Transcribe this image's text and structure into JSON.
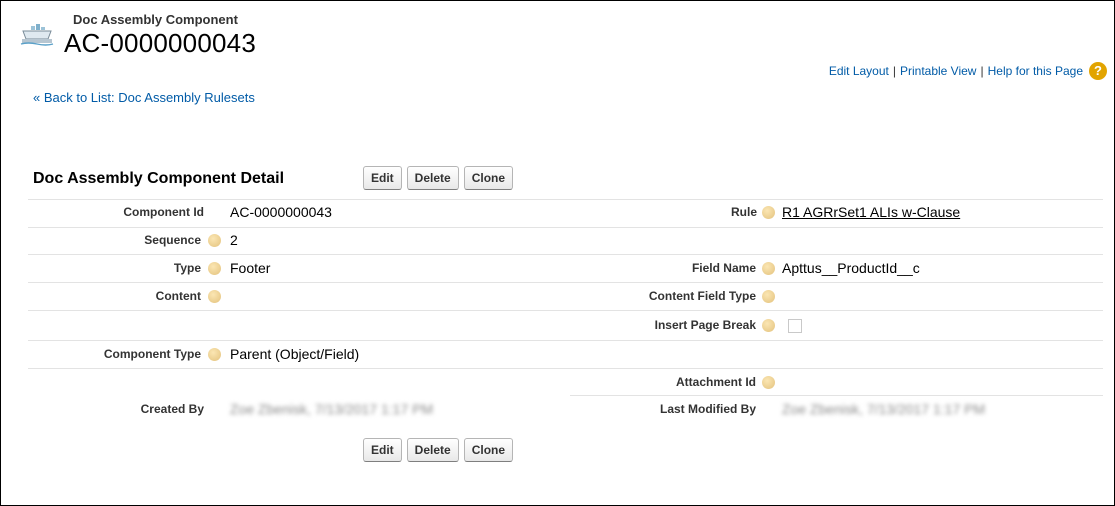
{
  "header": {
    "object_type": "Doc Assembly Component",
    "record_name": "AC-0000000043",
    "icon": "conveyor-ship-icon"
  },
  "top_links": {
    "edit_layout": "Edit Layout",
    "separator": "|",
    "printable_view": "Printable View",
    "help": "Help for this Page",
    "help_icon": "?"
  },
  "back_link": "« Back to List: Doc Assembly Rulesets",
  "detail": {
    "title": "Doc Assembly Component Detail",
    "buttons": {
      "edit": "Edit",
      "delete": "Delete",
      "clone": "Clone"
    },
    "fields": {
      "component_id": {
        "label": "Component Id",
        "value": "AC-0000000043"
      },
      "rule": {
        "label": "Rule",
        "value": "R1 AGRrSet1 ALIs w-Clause"
      },
      "sequence": {
        "label": "Sequence",
        "value": "2"
      },
      "type": {
        "label": "Type",
        "value": "Footer"
      },
      "field_name": {
        "label": "Field Name",
        "value": "Apttus__ProductId__c"
      },
      "content": {
        "label": "Content",
        "value": ""
      },
      "content_field_type": {
        "label": "Content Field Type",
        "value": ""
      },
      "insert_page_break": {
        "label": "Insert Page Break",
        "checked": false
      },
      "component_type": {
        "label": "Component Type",
        "value": "Parent (Object/Field)"
      },
      "attachment_id": {
        "label": "Attachment Id",
        "value": ""
      },
      "created_by": {
        "label": "Created By",
        "value": "Zoe Zbenisk, 7/13/2017 1:17 PM"
      },
      "last_modified_by": {
        "label": "Last Modified By",
        "value": "Zoe Zbenisk, 7/13/2017 1:17 PM"
      }
    }
  },
  "colors": {
    "link": "#015ba7",
    "help_icon": "#e2a400",
    "row_line": "#e3e3e3"
  }
}
